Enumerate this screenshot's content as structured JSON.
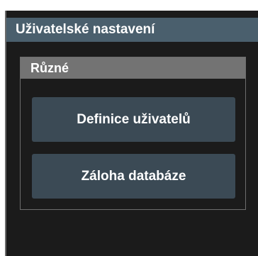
{
  "window": {
    "title": "Uživatelské nastavení"
  },
  "group": {
    "header": "Různé",
    "buttons": [
      {
        "label": "Definice uživatelů"
      },
      {
        "label": "Záloha databáze"
      }
    ]
  },
  "colors": {
    "title_bar": "#4a5f6d",
    "panel_bg": "#1b1b1b",
    "group_header": "#737373",
    "button_bg": "#3b4a55",
    "text": "#ffffff"
  }
}
